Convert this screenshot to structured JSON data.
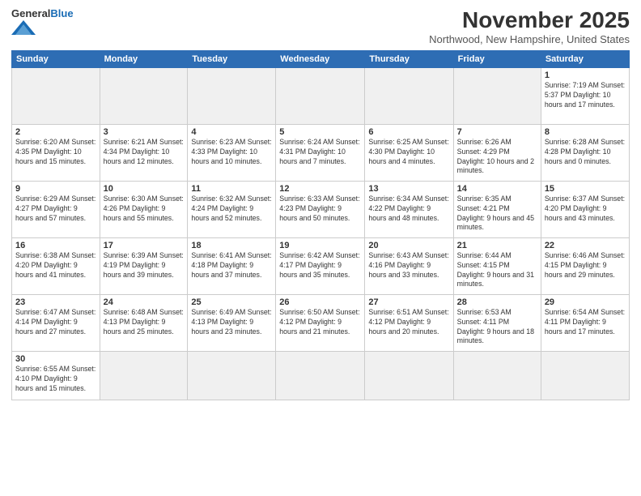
{
  "header": {
    "logo_general": "General",
    "logo_blue": "Blue",
    "month_title": "November 2025",
    "subtitle": "Northwood, New Hampshire, United States"
  },
  "days_of_week": [
    "Sunday",
    "Monday",
    "Tuesday",
    "Wednesday",
    "Thursday",
    "Friday",
    "Saturday"
  ],
  "weeks": [
    [
      {
        "day": "",
        "info": ""
      },
      {
        "day": "",
        "info": ""
      },
      {
        "day": "",
        "info": ""
      },
      {
        "day": "",
        "info": ""
      },
      {
        "day": "",
        "info": ""
      },
      {
        "day": "",
        "info": ""
      },
      {
        "day": "1",
        "info": "Sunrise: 7:19 AM\nSunset: 5:37 PM\nDaylight: 10 hours and 17 minutes."
      }
    ],
    [
      {
        "day": "2",
        "info": "Sunrise: 6:20 AM\nSunset: 4:35 PM\nDaylight: 10 hours and 15 minutes."
      },
      {
        "day": "3",
        "info": "Sunrise: 6:21 AM\nSunset: 4:34 PM\nDaylight: 10 hours and 12 minutes."
      },
      {
        "day": "4",
        "info": "Sunrise: 6:23 AM\nSunset: 4:33 PM\nDaylight: 10 hours and 10 minutes."
      },
      {
        "day": "5",
        "info": "Sunrise: 6:24 AM\nSunset: 4:31 PM\nDaylight: 10 hours and 7 minutes."
      },
      {
        "day": "6",
        "info": "Sunrise: 6:25 AM\nSunset: 4:30 PM\nDaylight: 10 hours and 4 minutes."
      },
      {
        "day": "7",
        "info": "Sunrise: 6:26 AM\nSunset: 4:29 PM\nDaylight: 10 hours and 2 minutes."
      },
      {
        "day": "8",
        "info": "Sunrise: 6:28 AM\nSunset: 4:28 PM\nDaylight: 10 hours and 0 minutes."
      }
    ],
    [
      {
        "day": "9",
        "info": "Sunrise: 6:29 AM\nSunset: 4:27 PM\nDaylight: 9 hours and 57 minutes."
      },
      {
        "day": "10",
        "info": "Sunrise: 6:30 AM\nSunset: 4:26 PM\nDaylight: 9 hours and 55 minutes."
      },
      {
        "day": "11",
        "info": "Sunrise: 6:32 AM\nSunset: 4:24 PM\nDaylight: 9 hours and 52 minutes."
      },
      {
        "day": "12",
        "info": "Sunrise: 6:33 AM\nSunset: 4:23 PM\nDaylight: 9 hours and 50 minutes."
      },
      {
        "day": "13",
        "info": "Sunrise: 6:34 AM\nSunset: 4:22 PM\nDaylight: 9 hours and 48 minutes."
      },
      {
        "day": "14",
        "info": "Sunrise: 6:35 AM\nSunset: 4:21 PM\nDaylight: 9 hours and 45 minutes."
      },
      {
        "day": "15",
        "info": "Sunrise: 6:37 AM\nSunset: 4:20 PM\nDaylight: 9 hours and 43 minutes."
      }
    ],
    [
      {
        "day": "16",
        "info": "Sunrise: 6:38 AM\nSunset: 4:20 PM\nDaylight: 9 hours and 41 minutes."
      },
      {
        "day": "17",
        "info": "Sunrise: 6:39 AM\nSunset: 4:19 PM\nDaylight: 9 hours and 39 minutes."
      },
      {
        "day": "18",
        "info": "Sunrise: 6:41 AM\nSunset: 4:18 PM\nDaylight: 9 hours and 37 minutes."
      },
      {
        "day": "19",
        "info": "Sunrise: 6:42 AM\nSunset: 4:17 PM\nDaylight: 9 hours and 35 minutes."
      },
      {
        "day": "20",
        "info": "Sunrise: 6:43 AM\nSunset: 4:16 PM\nDaylight: 9 hours and 33 minutes."
      },
      {
        "day": "21",
        "info": "Sunrise: 6:44 AM\nSunset: 4:15 PM\nDaylight: 9 hours and 31 minutes."
      },
      {
        "day": "22",
        "info": "Sunrise: 6:46 AM\nSunset: 4:15 PM\nDaylight: 9 hours and 29 minutes."
      }
    ],
    [
      {
        "day": "23",
        "info": "Sunrise: 6:47 AM\nSunset: 4:14 PM\nDaylight: 9 hours and 27 minutes."
      },
      {
        "day": "24",
        "info": "Sunrise: 6:48 AM\nSunset: 4:13 PM\nDaylight: 9 hours and 25 minutes."
      },
      {
        "day": "25",
        "info": "Sunrise: 6:49 AM\nSunset: 4:13 PM\nDaylight: 9 hours and 23 minutes."
      },
      {
        "day": "26",
        "info": "Sunrise: 6:50 AM\nSunset: 4:12 PM\nDaylight: 9 hours and 21 minutes."
      },
      {
        "day": "27",
        "info": "Sunrise: 6:51 AM\nSunset: 4:12 PM\nDaylight: 9 hours and 20 minutes."
      },
      {
        "day": "28",
        "info": "Sunrise: 6:53 AM\nSunset: 4:11 PM\nDaylight: 9 hours and 18 minutes."
      },
      {
        "day": "29",
        "info": "Sunrise: 6:54 AM\nSunset: 4:11 PM\nDaylight: 9 hours and 17 minutes."
      }
    ],
    [
      {
        "day": "30",
        "info": "Sunrise: 6:55 AM\nSunset: 4:10 PM\nDaylight: 9 hours and 15 minutes."
      },
      {
        "day": "",
        "info": ""
      },
      {
        "day": "",
        "info": ""
      },
      {
        "day": "",
        "info": ""
      },
      {
        "day": "",
        "info": ""
      },
      {
        "day": "",
        "info": ""
      },
      {
        "day": "",
        "info": ""
      }
    ]
  ]
}
